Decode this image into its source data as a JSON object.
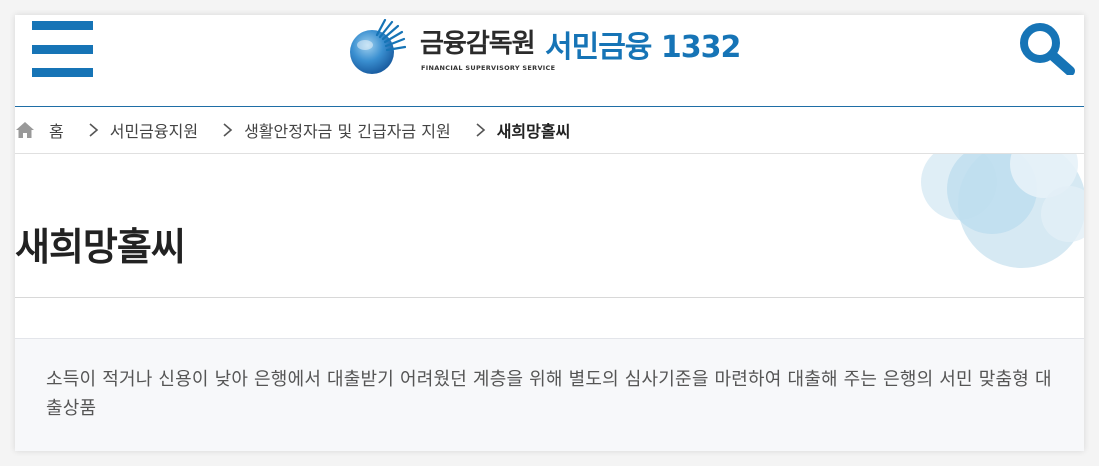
{
  "header": {
    "logo_org_korean": "금융감독원",
    "logo_org_english": "FINANCIAL SUPERVISORY SERVICE",
    "logo_service_name": "서민금융 1332",
    "menu_icon": "hamburger-menu-icon",
    "search_icon": "search-icon",
    "brand_color": "#1674b6"
  },
  "breadcrumb": {
    "home": "홈",
    "items": [
      "서민금융지원",
      "생활안정자금 및 긴급자금 지원"
    ],
    "current": "새희망홀씨"
  },
  "page": {
    "title": "새희망홀씨",
    "description": "소득이 적거나 신용이 낮아 은행에서 대출받기 어려웠던 계층을 위해 별도의 심사기준을 마련하여 대출해 주는 은행의 서민 맞춤형 대출상품"
  }
}
